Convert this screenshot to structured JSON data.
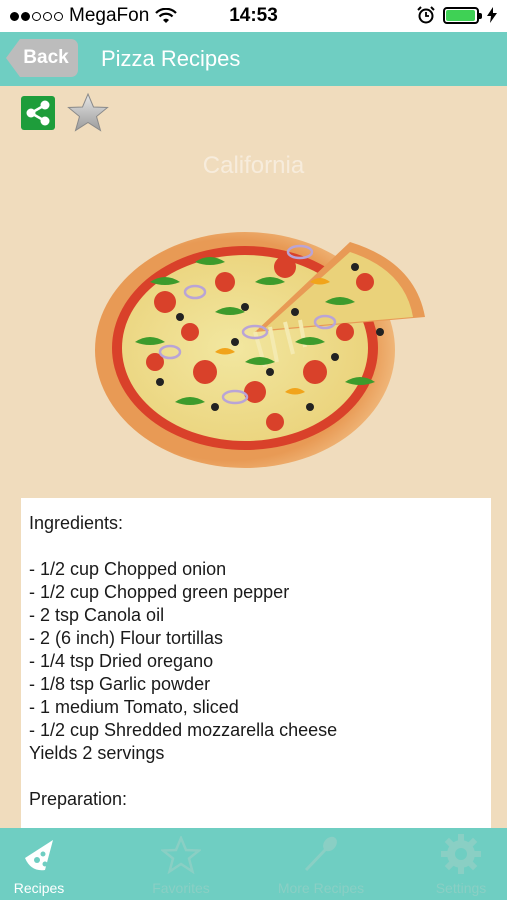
{
  "status_bar": {
    "carrier": "MegaFon",
    "time": "14:53",
    "signal_dots_filled": 2,
    "signal_dots_total": 5,
    "battery_level": 0.95
  },
  "nav": {
    "back_label": "Back",
    "title": "Pizza Recipes"
  },
  "recipe": {
    "title": "California",
    "text": "Ingredients:\n\n- 1/2 cup Chopped onion\n- 1/2 cup Chopped green pepper\n- 2 tsp Canola oil\n- 2 (6 inch) Flour tortillas\n- 1/4 tsp Dried oregano\n- 1/8 tsp Garlic powder\n- 1 medium Tomato, sliced\n- 1/2 cup Shredded mozzarella cheese\nYields 2 servings\n\nPreparation:"
  },
  "tabs": [
    {
      "label": "Recipes",
      "icon": "pizza-slice-icon",
      "active": true
    },
    {
      "label": "Favorites",
      "icon": "star-outline-icon",
      "active": false
    },
    {
      "label": "More Recipes",
      "icon": "spoon-icon",
      "active": false
    },
    {
      "label": "Settings",
      "icon": "gear-icon",
      "active": false
    }
  ],
  "colors": {
    "accent": "#6fcec2",
    "background": "#f0dcbd",
    "share_green": "#1e9d3b"
  }
}
